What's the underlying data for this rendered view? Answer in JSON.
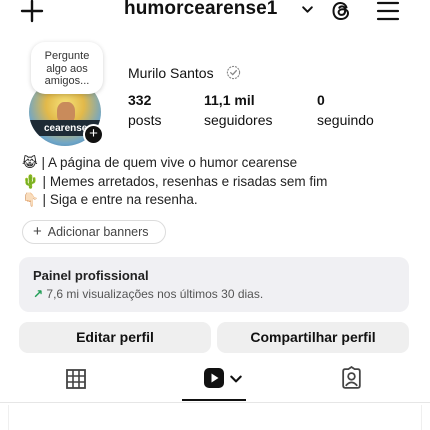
{
  "header": {
    "username": "humorcearense1"
  },
  "profile": {
    "note": [
      "Pergunte",
      "algo aos",
      "amigos..."
    ],
    "avatar_text": "cearense",
    "display_name": "Murilo Santos",
    "stats": [
      {
        "value": "332",
        "label": "posts"
      },
      {
        "value": "11,1 mil",
        "label": "seguidores"
      },
      {
        "value": "0",
        "label": "seguindo"
      }
    ],
    "bio": [
      "😹 | A página de quem vive o humor cearense",
      "🌵 | Memes arretados, resenhas e risadas sem fim",
      "👇🏻 | Siga e entre na resenha."
    ],
    "banner_button": "Adicionar banners"
  },
  "dashboard": {
    "title": "Painel profissional",
    "subtitle": "7,6 mi visualizações nos últimos 30 dias."
  },
  "actions": {
    "edit": "Editar perfil",
    "share": "Compartilhar perfil"
  },
  "icons": {
    "top_left": "plus-icon",
    "username_dropdown": "chevron-down-icon",
    "threads": "threads-icon",
    "menu": "hamburger-menu-icon",
    "tab_grid": "grid-icon",
    "tab_reels": "reels-icon",
    "tab_tagged": "tagged-person-icon"
  },
  "colors": {
    "panel_bg": "#f0f0f3",
    "button_bg": "#efefef",
    "trend_arrow": "#1f9d55"
  }
}
